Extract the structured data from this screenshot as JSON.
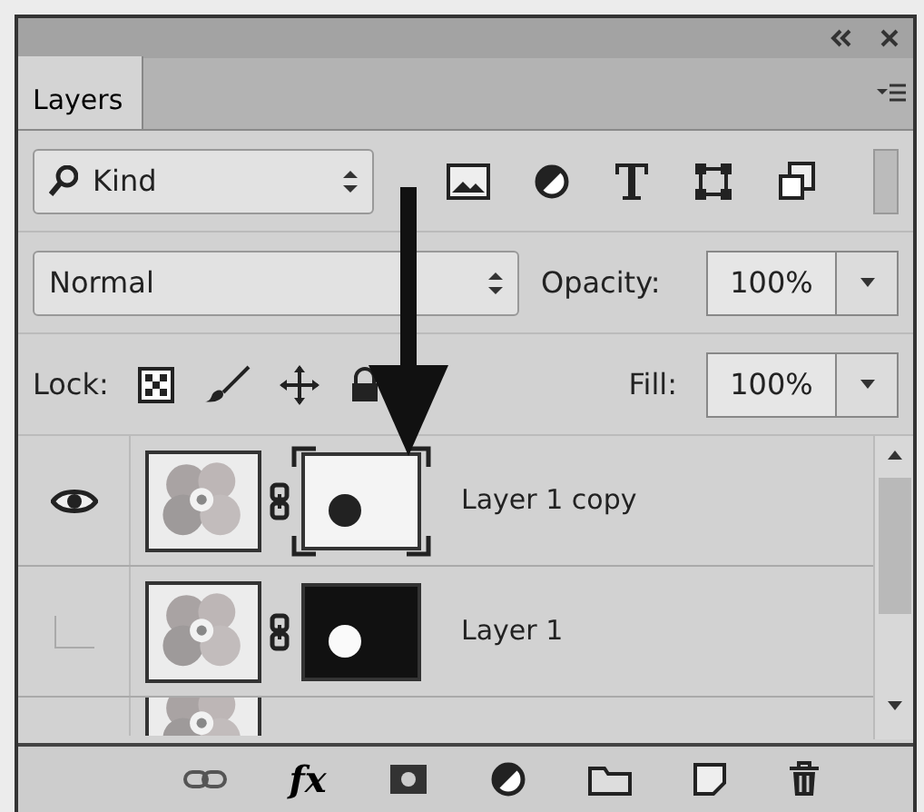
{
  "tabs": [
    {
      "label": "Layers",
      "selected": true
    }
  ],
  "filter": {
    "value": "Kind"
  },
  "blend_mode": {
    "value": "Normal"
  },
  "opacity": {
    "label": "Opacity:",
    "value": "100%"
  },
  "lock": {
    "label": "Lock:"
  },
  "fill": {
    "label": "Fill:",
    "value": "100%"
  },
  "layers": [
    {
      "kind": "full",
      "name": "Layer 1 copy",
      "visible": true,
      "mask_dark": false,
      "mask_selected": true
    },
    {
      "kind": "full",
      "name": "Layer 1",
      "visible": false,
      "mask_dark": true,
      "mask_selected": false
    },
    {
      "kind": "partial"
    }
  ],
  "footer": {
    "effects_label": "fx"
  }
}
